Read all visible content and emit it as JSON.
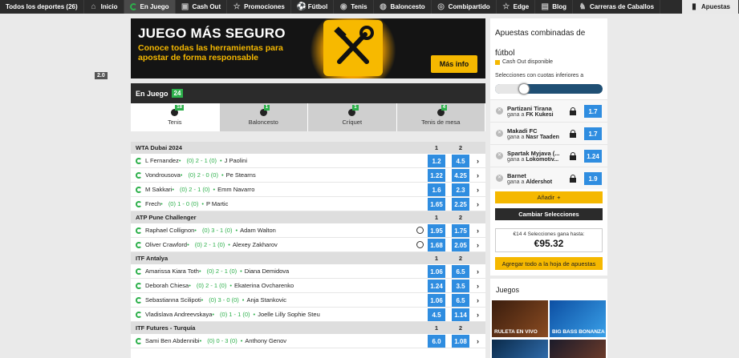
{
  "nav": {
    "items": [
      {
        "label": "Todos los deportes (26)",
        "icon": "",
        "active": false
      },
      {
        "label": "Inicio",
        "icon": "home-icon",
        "active": false
      },
      {
        "label": "En Juego",
        "icon": "live-icon",
        "active": true
      },
      {
        "label": "Cash Out",
        "icon": "cashout-icon",
        "active": false
      },
      {
        "label": "Promociones",
        "icon": "star-icon",
        "active": false
      },
      {
        "label": "Fútbol",
        "icon": "football-icon",
        "active": false
      },
      {
        "label": "Tenis",
        "icon": "tennis-icon",
        "active": false
      },
      {
        "label": "Baloncesto",
        "icon": "basketball-icon",
        "active": false
      },
      {
        "label": "Combipartido",
        "icon": "combi-icon",
        "active": false
      },
      {
        "label": "Edge",
        "icon": "star-icon",
        "active": false
      },
      {
        "label": "Blog",
        "icon": "blog-icon",
        "active": false
      },
      {
        "label": "Carreras de Caballos",
        "icon": "horse-icon",
        "active": false
      }
    ],
    "apuestas": "Apuestas"
  },
  "banner": {
    "title": "JUEGO MÁS SEGURO",
    "subtitle": "Conoce todas las herramientas para apostar de forma responsable",
    "cta": "Más info"
  },
  "live": {
    "title": "En Juego",
    "count": "24"
  },
  "tabs": [
    {
      "label": "Tenis",
      "count": "18",
      "active": true
    },
    {
      "label": "Baloncesto",
      "count": "1",
      "active": false
    },
    {
      "label": "Críquet",
      "count": "1",
      "active": false
    },
    {
      "label": "Tenis de mesa",
      "count": "4",
      "active": false
    }
  ],
  "leagues": [
    {
      "name": "WTA Dubai 2024",
      "col1": "1",
      "col2": "2",
      "events": [
        {
          "p1": "L Fernandez",
          "score": "(0) 2 - 1 (0)",
          "p2": "J Paolini",
          "o1": "1.2",
          "o2": "4.5",
          "stream": false
        },
        {
          "p1": "Vondrousova",
          "score": "(0) 2 - 0 (0)",
          "p2": "Pe Stearns",
          "o1": "1.22",
          "o2": "4.25",
          "stream": false
        },
        {
          "p1": "M Sakkari",
          "score": "(0) 2 - 1 (0)",
          "p2": "Emm Navarro",
          "o1": "1.6",
          "o2": "2.3",
          "stream": false
        },
        {
          "p1": "Frech",
          "score": "(0) 1 - 0 (0)",
          "p2": "P Martic",
          "o1": "1.65",
          "o2": "2.25",
          "stream": false
        }
      ]
    },
    {
      "name": "ATP Pune Challenger",
      "col1": "1",
      "col2": "2",
      "events": [
        {
          "p1": "Raphael Collignon",
          "score": "(0) 3 - 1 (0)",
          "p2": "Adam Walton",
          "o1": "1.95",
          "o2": "1.75",
          "stream": true
        },
        {
          "p1": "Oliver Crawford",
          "score": "(0) 2 - 1 (0)",
          "p2": "Alexey Zakharov",
          "o1": "1.68",
          "o2": "2.05",
          "stream": true
        }
      ]
    },
    {
      "name": "ITF Antalya",
      "col1": "1",
      "col2": "2",
      "events": [
        {
          "p1": "Amarissa Kiara Toth",
          "score": "(0) 2 - 1 (0)",
          "p2": "Diana Demidova",
          "o1": "1.06",
          "o2": "6.5",
          "stream": false
        },
        {
          "p1": "Deborah Chiesa",
          "score": "(0) 2 - 1 (0)",
          "p2": "Ekaterina Ovcharenko",
          "o1": "1.24",
          "o2": "3.5",
          "stream": false
        },
        {
          "p1": "Sebastianna Scilipoti",
          "score": "(0) 3 - 0 (0)",
          "p2": "Anja Stankovic",
          "o1": "1.06",
          "o2": "6.5",
          "stream": false
        },
        {
          "p1": "Vladislava Andreevskaya",
          "score": "(0) 1 - 1 (0)",
          "p2": "Joelle Lilly Sophie Steu",
          "o1": "4.5",
          "o2": "1.14",
          "stream": false
        }
      ]
    },
    {
      "name": "ITF Futures - Turquía",
      "col1": "1",
      "col2": "2",
      "events": [
        {
          "p1": "Sami Ben Abdennibi",
          "score": "(0) 0 - 3 (0)",
          "p2": "Anthony Genov",
          "o1": "6.0",
          "o2": "1.08",
          "stream": false
        }
      ]
    }
  ],
  "slip": {
    "title": "Apuestas combinadas de fútbol",
    "cashout": "Cash Out disponible",
    "selection_label": "Selecciones con cuotas inferiores a",
    "selection_value": "2.0",
    "slider_level": 0.27,
    "picks": [
      {
        "team": "Partizani Tirana",
        "text": "gana a",
        "opp": "FK Kukesi",
        "odd": "1.7"
      },
      {
        "team": "Makadi FC",
        "text": "gana a",
        "opp": "Nasr Taaden",
        "odd": "1.7"
      },
      {
        "team": "Spartak Myjava (...",
        "text": "gana a",
        "opp": "Lokomotiv...",
        "odd": "1.24"
      },
      {
        "team": "Barnet",
        "text": "gana a",
        "opp": "Aldershot",
        "odd": "1.9"
      }
    ],
    "add_label": "Añadir",
    "change_label": "Cambiar Selecciones",
    "win_text": "€14 4 Selecciones gana hasta:",
    "win_amount": "€95.32",
    "add_all_label": "Agregar todo a la hoja de apuestas"
  },
  "games": {
    "title": "Juegos",
    "tiles": [
      {
        "label": "RULETA EN VIVO",
        "colors": [
          "#3a1d0e",
          "#8a4b21"
        ]
      },
      {
        "label": "BIG BASS BONANZA",
        "colors": [
          "#0d4fa3",
          "#39a0e8"
        ]
      },
      {
        "label": "",
        "colors": [
          "#0a2a4a",
          "#2f6aa8"
        ]
      },
      {
        "label": "",
        "colors": [
          "#1b1b2a",
          "#6a3a2a"
        ]
      }
    ]
  },
  "colors": {
    "accent": "#f5b800",
    "odd": "#2f8de0",
    "live": "#2db04b",
    "dark": "#2b2b2b"
  }
}
